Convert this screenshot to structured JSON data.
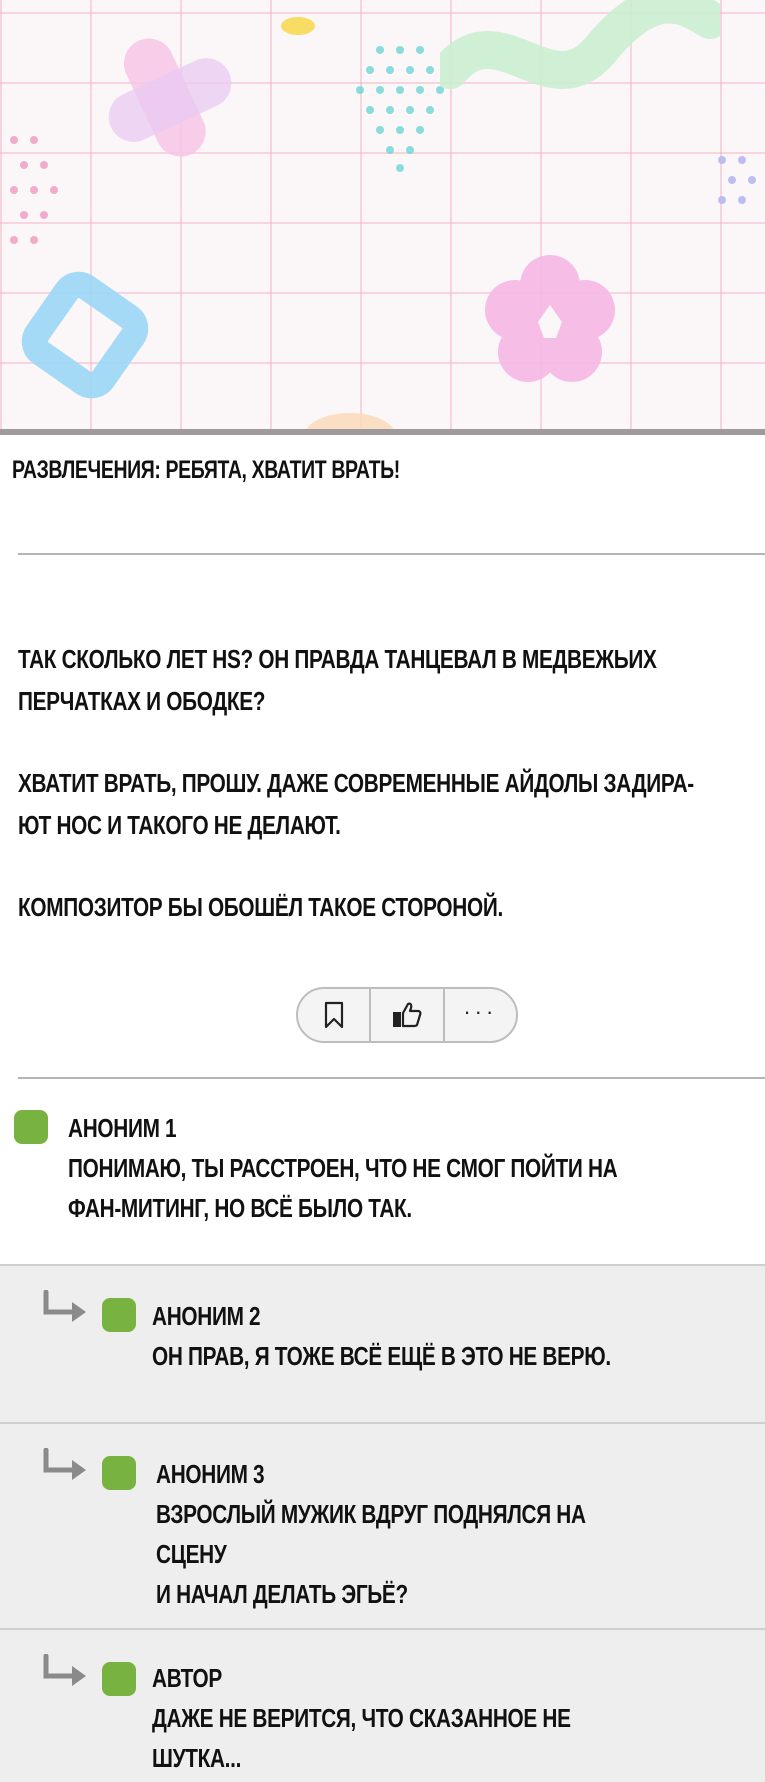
{
  "post": {
    "title": "РАЗВЛЕЧЕНИЯ: РЕБЯТА, ХВАТИТ ВРАТЬ!",
    "paragraphs": [
      "ТАК СКОЛЬКО ЛЕТ HS? ОН ПРАВДА ТАНЦЕВАЛ В МЕДВЕЖЬИХ\nПЕРЧАТКАХ И ОБОДКЕ?",
      "ХВАТИТ ВРАТЬ, ПРОШУ. ДАЖЕ СОВРЕМЕННЫЕ АЙДОЛЫ ЗАДИРА-\nЮТ НОС И ТАКОГО НЕ ДЕЛАЮТ.",
      "КОМПОЗИТОР БЫ ОБОШЁЛ ТАКОЕ СТОРОНОЙ."
    ]
  },
  "actions": {
    "bookmark_icon": "bookmark-icon",
    "like_icon": "thumbs-up-icon",
    "more_label": "···"
  },
  "colors": {
    "avatar": "#78b240",
    "reply_bg": "#eeeeee",
    "divider": "#b5b5b5"
  },
  "comments": [
    {
      "author": "АНОНИМ 1",
      "text": "ПОНИМАЮ, ТЫ РАССТРОЕН, ЧТО НЕ СМОГ ПОЙТИ НА\nФАН-МИТИНГ, НО ВСЁ БЫЛО ТАК.",
      "is_reply": false
    },
    {
      "author": "АНОНИМ 2",
      "text": "ОН ПРАВ, Я ТОЖЕ ВСЁ ЕЩЁ В ЭТО НЕ ВЕРЮ.",
      "is_reply": true
    },
    {
      "author": "АНОНИМ 3",
      "text": "ВЗРОСЛЫЙ МУЖИК ВДРУГ ПОДНЯЛСЯ НА СЦЕНУ\nИ НАЧАЛ ДЕЛАТЬ ЭГЬЁ?",
      "is_reply": true
    },
    {
      "author": "АВТОР",
      "text": "ДАЖЕ НЕ ВЕРИТСЯ, ЧТО СКАЗАННОЕ НЕ ШУТКА...",
      "is_reply": true
    }
  ]
}
